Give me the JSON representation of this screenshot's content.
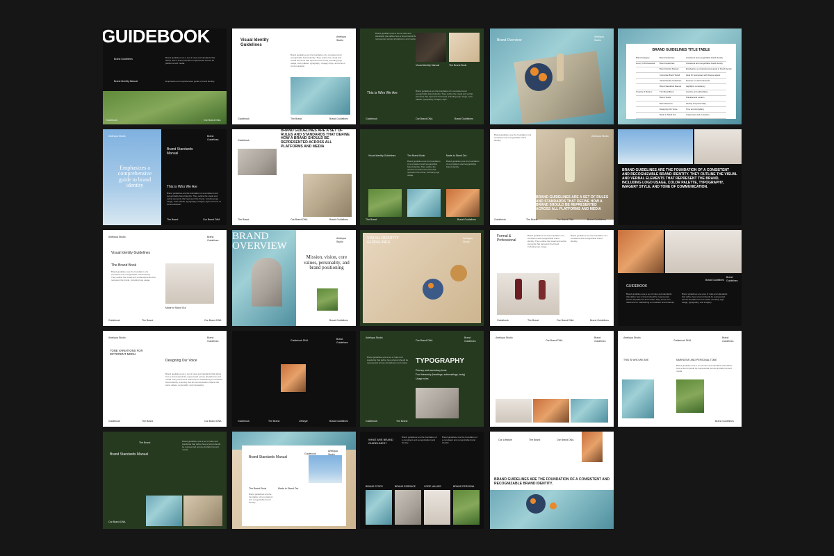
{
  "cover": {
    "title": "GUIDEBOOK",
    "items": [
      {
        "label": "Brand Guidelines",
        "text": "Brand guidelines are a set of rules and standards that define how a brand should be represented across all platforms and media."
      },
      {
        "label": "Brand Identity Manual",
        "text": "Emphasizes a comprehensive guide to brand identity."
      }
    ],
    "footer": [
      "Guidebook",
      "Our Brand DNA"
    ]
  },
  "s2": {
    "title": "Visual Identity Guidelines",
    "studio": "Arteliqua Studio",
    "text": "Brand guidelines are the foundation of a consistent and recognizable brand identity. They outline the visual and verbal elements that represent the brand, including logo usage, color palette, typography, imagery style, and tone of communication.",
    "footer": [
      "Guidebook",
      "The Brand",
      "Brand Guidelines"
    ]
  },
  "s3": {
    "intro": "Brand guidelines are a set of rules and standards that define how a brand should be represented across all platforms and media.",
    "captions": [
      "Visual Identity Manual",
      "The Brand Book"
    ],
    "heading": "This is Who We Are",
    "text": "Brand guidelines are the foundation of a consistent and recognizable brand identity. They outline the visual and verbal elements that represent the brand, including logo usage, color palette, typography, imagery style.",
    "footer": [
      "Guidebook",
      "Our Brand DNA",
      "Brand Guidelines"
    ]
  },
  "s4": {
    "title": "Brand Overview",
    "studio": "Arteliqua Studio"
  },
  "s5": {
    "title": "BRAND GUIDELINES TITLE TABLE",
    "rows": [
      [
        "Brand Category",
        "Brand Guidelines",
        "Consistent and recognizable brand identity"
      ],
      [
        "Luxury & Professional",
        "Brand Guidelines",
        "Consistent and recognizable brand identity"
      ],
      [
        "",
        "Brand Identity Manual",
        "Emphasizes a comprehensive guide to brand identity"
      ],
      [
        "",
        "Corporate Brand Toolkit",
        "Ideal for businesses with diverse assets"
      ],
      [
        "",
        "Visual Identity Guidelines",
        "Focuses on visual elements"
      ],
      [
        "",
        "Brand Standards Manual",
        "Highlights consistency"
      ],
      [
        "Creative & Modern",
        "The Brand Book",
        "Concise and authoritative"
      ],
      [
        "",
        "Brand Toolkit",
        "Practical and modern"
      ],
      [
        "",
        "Brand Essence",
        "Identity and personality"
      ],
      [
        "",
        "Designing Our Voice",
        "Tone and storytelling"
      ],
      [
        "",
        "Made to Stand Out",
        "Uniqueness and innovation"
      ]
    ]
  },
  "s6": {
    "studio": "Arteliqua Studio",
    "title": "Brand Standards Manual",
    "quote": "Emphasizes a comprehensive guide to brand identity",
    "heading": "This is Who We Are",
    "text": "Brand guidelines are the foundation of a consistent and recognizable brand identity. They outline the visual and verbal elements that represent the brand, including logo usage, color palette, typography, imagery style and tone of communication.",
    "tag": "Brand Guidelines",
    "footer": [
      "The Brand",
      "Our Brand DNA"
    ]
  },
  "s7": {
    "headline": "BRAND GUIDELINES ARE A SET OF RULES AND STANDARDS THAT DEFINE HOW A BRAND SHOULD BE REPRESENTED ACROSS ALL PLATFORMS AND MEDIA",
    "tag": "Guidebook",
    "footer": [
      "The Brand",
      "Our Brand DNA",
      "Brand Guidelines"
    ]
  },
  "s8": {
    "columns": [
      {
        "title": "Visual Identity Guidelines",
        "text": ""
      },
      {
        "title": "The Brand Book",
        "text": "Brand guidelines are the foundation of a consistent and recognizable brand identity. They outline the visual and verbal elements that represent the brand, including logo usage."
      },
      {
        "title": "Made to Stand Out",
        "text": "Brand guidelines are the foundation of a consistent and recognizable brand identity."
      }
    ],
    "footer": [
      "The Brand",
      "Brand Guidelines"
    ]
  },
  "s9": {
    "text": "Brand guidelines are the foundation of a consistent and recognizable brand identity.",
    "studio": "Arteliqua Studio",
    "headline": "BRAND GUIDELINES ARE A SET OF RULES AND STANDARDS THAT DEFINE HOW A BRAND SHOULD BE REPRESENTED ACROSS ALL PLATFORMS AND MEDIA",
    "footer": [
      "Guidebook",
      "The Brand",
      "Our Brand DNA",
      "Brand Guidelines"
    ]
  },
  "s10": {
    "headline": "BRAND GUIDELINES ARE THE FOUNDATION OF A CONSISTENT AND RECOGNIZABLE BRAND IDENTITY. THEY OUTLINE THE VISUAL AND VERBAL ELEMENTS THAT REPRESENT THE BRAND, INCLUDING LOGO USAGE, COLOR PALETTE, TYPOGRAPHY, IMAGERY STYLE, AND TONE OF COMMUNICATION."
  },
  "s11": {
    "studio": "Arteliqua Studio",
    "tag": "Brand Guidelines",
    "title": "Visual Identity Guidelines",
    "subtitle": "The Brand Book",
    "text": "Brand guidelines are the foundation of a consistent and recognizable brand identity. They outline the visual and verbal elements that represent the brand, including logo usage.",
    "caption": "Made to Stand Out",
    "footer": [
      "Guidebook",
      "The Brand",
      "Our Brand DNA"
    ]
  },
  "s12": {
    "title": "BRAND OVERVIEW",
    "studio": "Arteliqua Studio",
    "quote": "Mission, vision, core values, personality, and brand positioning",
    "footer": [
      "Brand Guidelines"
    ]
  },
  "s13": {
    "title": "VISUAL IDENTITY GUIDELINES",
    "studio": "Arteliqua Studio"
  },
  "s14": {
    "title": "Formal & Professional",
    "text1": "Brand guidelines are the foundation of a consistent and recognizable brand identity. They outline the visual and verbal elements that represent the brand, including logo usage.",
    "text2": "Brand guidelines are the foundation of a consistent and recognizable brand identity.",
    "footer": [
      "Guidebook",
      "The Brand",
      "Our Brand DNA",
      "Brand Guidelines"
    ]
  },
  "s15": {
    "title": "GUIDEBOOK",
    "tag": "Brand Guidelines",
    "tag2": "Brand Guidelines",
    "text1": "Brand guidelines are a set of rules and standards that define how a brand should be represented across all platforms and media. They serve as a reference for maintaining a consistent brand identity.",
    "text2": "Brand guidelines are a set of rules and standards that define how a brand should be represented across all platforms and media, including logo usage, typography, and imagery."
  },
  "s16": {
    "studio": "Arteliqua Studio",
    "tag": "Brand Guidelines",
    "title": "TONE VARIATIONS FOR DIFFERENT MEDIA",
    "heading": "Designing Our Voice",
    "text": "Brand guidelines are a set of rules and standards that define how a brand should be represented across all platforms and media. They serve as a reference for maintaining a consistent brand identity, ensuring that all communication reflects the same values, personality, and messaging.",
    "footer": [
      "Guidebook",
      "The Brand",
      "Our Brand DNA"
    ]
  },
  "s17": {
    "tag": "Guidebook DNA",
    "tag2": "Brand Guidelines",
    "footer": [
      "Guidebook",
      "The Brand",
      "Lifestyle",
      "Brand Guidelines"
    ]
  },
  "s18": {
    "studio": "Arteliqua Studio",
    "tag": "Our Brand DNA",
    "tag2": "Brand Guidelines",
    "title": "TYPOGRAPHY",
    "items": [
      "Primary and secondary fonts",
      "Font hierarchy (headings, subheadings, body)",
      "Usage rules"
    ],
    "text": "Brand guidelines are a set of rules and standards that define how a brand should be represented across all platforms and media.",
    "footer": [
      "Guidebook",
      "The Brand"
    ]
  },
  "s19": {
    "studio": "Arteliqua Studio",
    "tag": "Our Brand DNA",
    "tag2": "Brand Guidelines",
    "footer": [
      "Guidebook",
      "The Brand"
    ]
  },
  "s20": {
    "studio": "Arteliqua Studio",
    "tag": "Guidebook DNA",
    "tag2": "Brand Guidelines",
    "heading1": "THIS IS WHO WE ARE",
    "heading2": "NARRATIVE AND PERSONAL TONE",
    "text": "Brand guidelines are a set of rules and standards that define how a brand should be represented across all platforms and media.",
    "footer": [
      "Brand Guidelines"
    ]
  },
  "s21": {
    "tag": "The Brand",
    "title": "Brand Standards Manual",
    "text": "Brand guidelines are a set of rules and standards that define how a brand should be represented across all platforms and media.",
    "footer": [
      "Our Brand DNA"
    ]
  },
  "s22": {
    "studio": "Arteliqua Studio",
    "tag": "Guidebook",
    "title": "Brand Standards Manual",
    "col1": "The Brand Book",
    "col2": "Made to Stand Out",
    "text": "Brand guidelines are the foundation of a consistent and recognizable brand identity."
  },
  "s23": {
    "title": "WHAT ARE BRAND GUIDELINES?",
    "text": "Brand guidelines are the foundation of a consistent and recognizable brand identity.",
    "labels": [
      "BRAND STORY",
      "BRAND ESSENCE",
      "CORE VALUES",
      "BRAND PERSONA"
    ]
  },
  "s24": {
    "tags": [
      "Our Lifestyle",
      "The Brand",
      "Our Brand DNA"
    ],
    "headline": "BRAND GUIDELINES ARE THE FOUNDATION OF A CONSISTENT AND RECOGNIZABLE BRAND IDENTITY."
  }
}
